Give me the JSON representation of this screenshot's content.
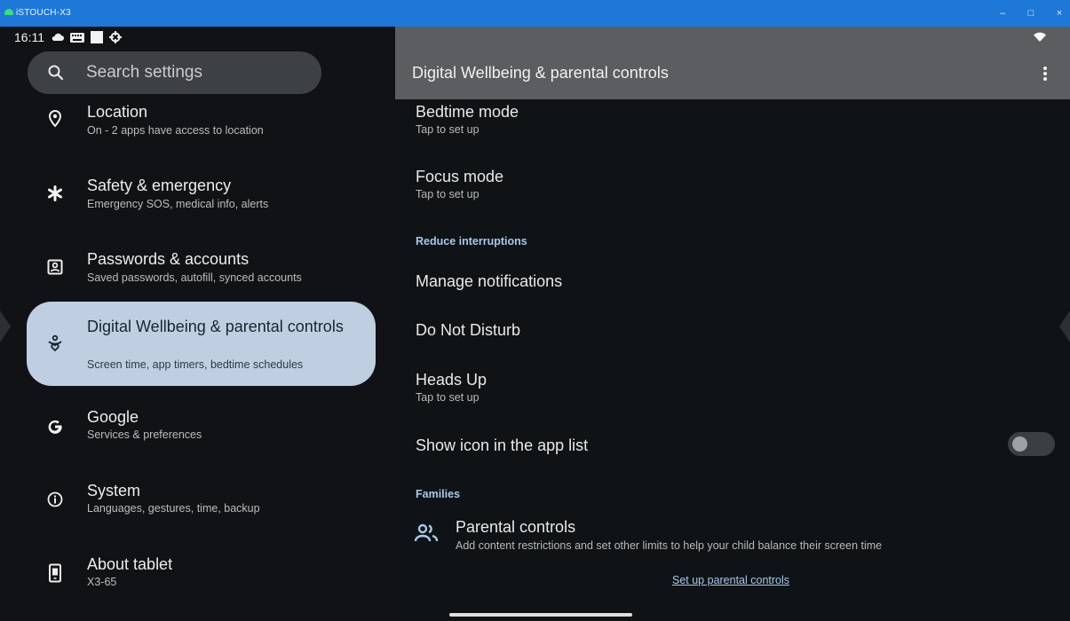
{
  "window": {
    "title": "iSTOUCH-X3",
    "controls": {
      "minimize": "–",
      "maximize": "□",
      "close": "×"
    }
  },
  "status_bar": {
    "time": "16:11",
    "icons": [
      "cloud-icon",
      "keyboard-icon",
      "square-icon",
      "settings-gear-icon"
    ],
    "right_icons": [
      "wifi-icon"
    ]
  },
  "search": {
    "placeholder": "Search settings"
  },
  "sidebar": {
    "items": [
      {
        "title": "Location",
        "subtitle": "On - 2 apps have access to location",
        "icon": "location-pin-icon"
      },
      {
        "title": "Safety & emergency",
        "subtitle": "Emergency SOS, medical info, alerts",
        "icon": "asterisk-icon"
      },
      {
        "title": "Passwords & accounts",
        "subtitle": "Saved passwords, autofill, synced accounts",
        "icon": "account-box-icon"
      },
      {
        "title": "Digital Wellbeing & parental controls",
        "subtitle": "Screen time, app timers, bedtime schedules",
        "icon": "wellbeing-icon",
        "selected": true
      },
      {
        "title": "Google",
        "subtitle": "Services & preferences",
        "icon": "google-icon"
      },
      {
        "title": "System",
        "subtitle": "Languages, gestures, time, backup",
        "icon": "info-icon"
      },
      {
        "title": "About tablet",
        "subtitle": "X3-65",
        "icon": "tablet-icon"
      }
    ]
  },
  "detail": {
    "title": "Digital Wellbeing & parental controls",
    "prefs": {
      "bedtime": {
        "title": "Bedtime mode",
        "subtitle": "Tap to set up"
      },
      "focus": {
        "title": "Focus mode",
        "subtitle": "Tap to set up"
      },
      "reduce_header": "Reduce interruptions",
      "manage_notifications": {
        "title": "Manage notifications"
      },
      "dnd": {
        "title": "Do Not Disturb"
      },
      "heads_up": {
        "title": "Heads Up",
        "subtitle": "Tap to set up"
      },
      "show_icon": {
        "title": "Show icon in the app list",
        "enabled": false
      },
      "families_header": "Families",
      "parental": {
        "title": "Parental controls",
        "subtitle": "Add content restrictions and set other limits to help your child balance their screen time",
        "link": "Set up parental controls"
      }
    }
  },
  "colors": {
    "accent_text": "#a9c7ea",
    "selected_bg": "#bfcfe1",
    "titlebar": "#1e78d7",
    "header": "#5b5d60"
  }
}
